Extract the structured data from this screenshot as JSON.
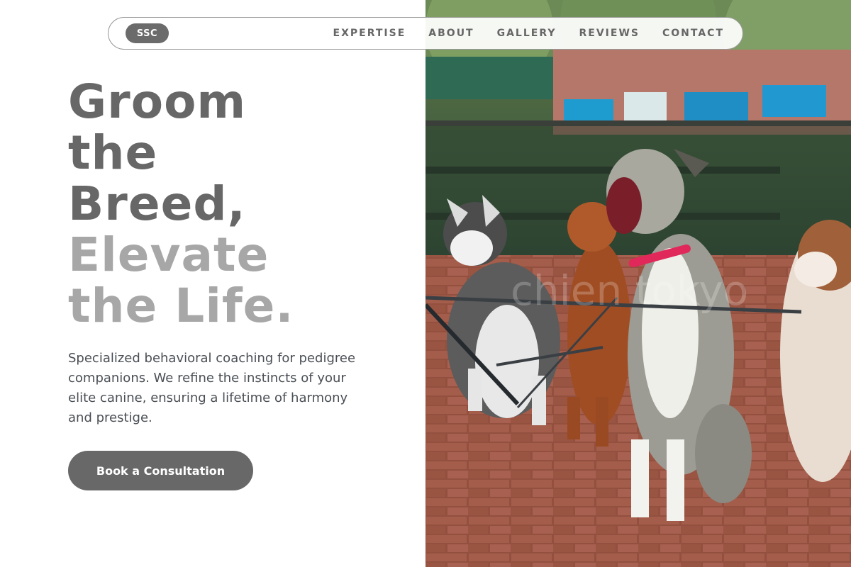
{
  "nav": {
    "logo": "SSC",
    "links": [
      "EXPERTISE",
      "ABOUT",
      "GALLERY",
      "REVIEWS",
      "CONTACT"
    ]
  },
  "hero": {
    "title_dark": [
      "Groom",
      "the",
      "Breed,"
    ],
    "title_light": [
      "Elevate",
      "the Life."
    ],
    "description": "Specialized behavioral coaching for pedigree companions. We refine the instincts of your elite canine, ensuring a lifetime of harmony and prestige.",
    "cta_label": "Book a Consultation"
  },
  "image": {
    "watermark": "chien tokyo"
  },
  "colors": {
    "heading_dark": "#676767",
    "heading_light": "#a7a7a7",
    "button": "#686868",
    "body_text": "#4a4f55"
  }
}
